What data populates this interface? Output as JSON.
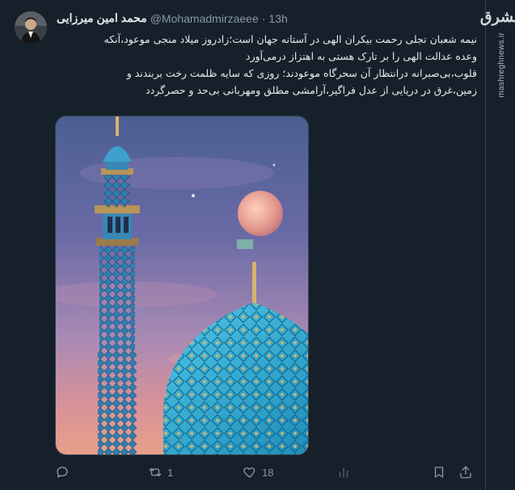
{
  "watermark": {
    "logo": "مشرق",
    "url": "mashreghnews.ir"
  },
  "tweet": {
    "author_name": "محمد امین میرزایی",
    "handle": "@Mohamadmirzaeee",
    "separator": "·",
    "time": "13h",
    "lines": [
      "نیمه شعبان تجلی رحمت بیکران الهی در آستانه جهان است؛زادروز میلاد منجی موعود،آنکه",
      "وعده عدالت الهی را بر تارک هستی به اهتزاز درمی‌آورد",
      "قلوب،بی‌صبرانه درانتظار آن سحرگاه موعودند؛ روزی که سایه ظلمت رخت بربندند و",
      "زمین،غرق در دریایی از عدل فراگیر،آرامشی مطلق ومهربانی بی‌حد و حصرگردد"
    ]
  },
  "actions": {
    "replies_icon": "reply-icon",
    "retweet_icon": "retweet-icon",
    "retweets": "1",
    "like_icon": "heart-icon",
    "likes": "18",
    "views_icon": "analytics-icon",
    "bookmark_icon": "bookmark-icon",
    "share_icon": "share-icon"
  }
}
